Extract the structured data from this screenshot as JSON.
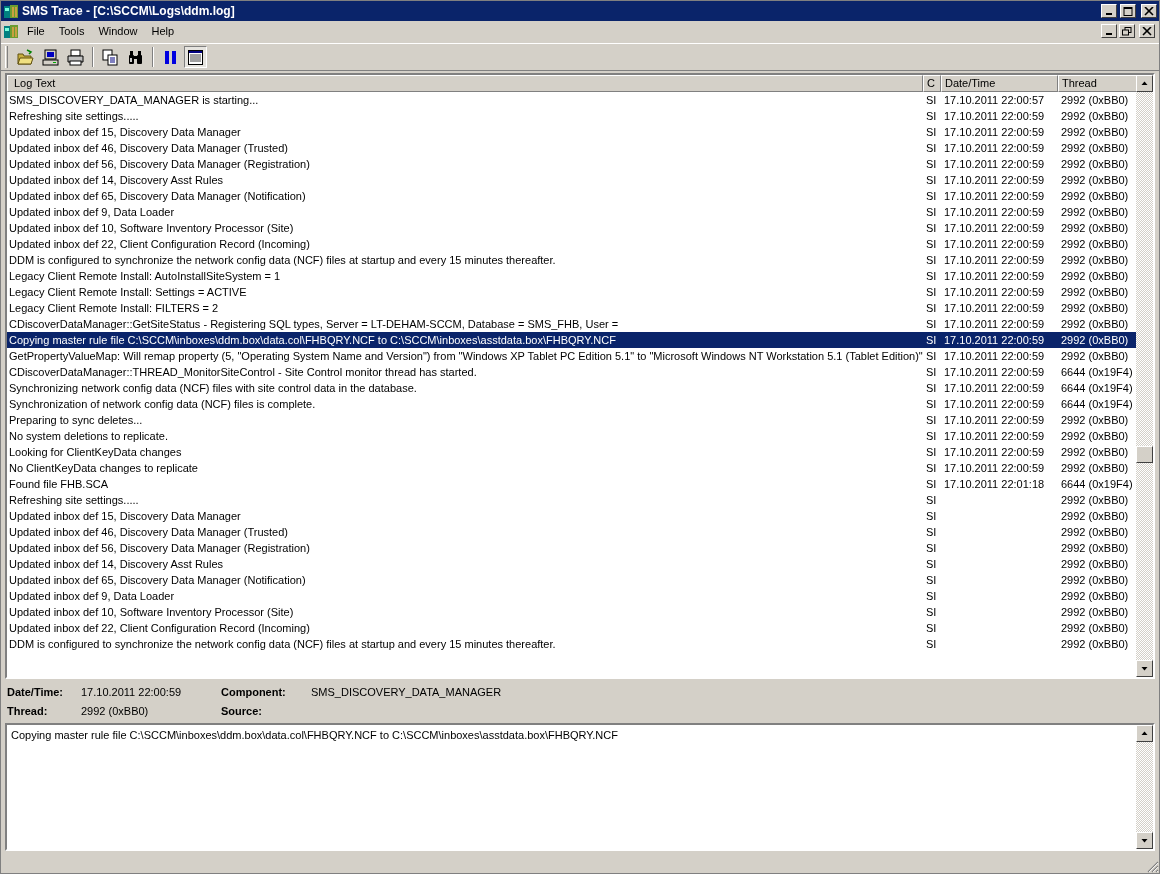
{
  "window": {
    "title": "SMS Trace - [C:\\SCCM\\Logs\\ddm.log]"
  },
  "menu": [
    {
      "label": "File"
    },
    {
      "label": "Tools"
    },
    {
      "label": "Window"
    },
    {
      "label": "Help"
    }
  ],
  "toolbar": [
    {
      "pressed": false
    },
    {
      "pressed": false
    },
    {
      "pressed": false
    },
    {
      "pressed": false
    },
    {
      "pressed": false
    },
    {
      "pressed": false
    },
    {
      "pressed": true
    }
  ],
  "columns": [
    {
      "label": "Log Text"
    },
    {
      "label": "C"
    },
    {
      "label": "Date/Time"
    },
    {
      "label": "Thread"
    }
  ],
  "rows": [
    {
      "text": "SMS_DISCOVERY_DATA_MANAGER is starting...",
      "component": "SI",
      "datetime": "17.10.2011 22:00:57",
      "thread": "2992 (0xBB0)",
      "selected": false
    },
    {
      "text": "Refreshing site settings.....",
      "component": "SI",
      "datetime": "17.10.2011 22:00:59",
      "thread": "2992 (0xBB0)",
      "selected": false
    },
    {
      "text": "Updated inbox def 15, Discovery Data Manager",
      "component": "SI",
      "datetime": "17.10.2011 22:00:59",
      "thread": "2992 (0xBB0)",
      "selected": false
    },
    {
      "text": "Updated inbox def 46, Discovery Data Manager (Trusted)",
      "component": "SI",
      "datetime": "17.10.2011 22:00:59",
      "thread": "2992 (0xBB0)",
      "selected": false
    },
    {
      "text": "Updated inbox def 56, Discovery Data Manager (Registration)",
      "component": "SI",
      "datetime": "17.10.2011 22:00:59",
      "thread": "2992 (0xBB0)",
      "selected": false
    },
    {
      "text": "Updated inbox def 14, Discovery Asst Rules",
      "component": "SI",
      "datetime": "17.10.2011 22:00:59",
      "thread": "2992 (0xBB0)",
      "selected": false
    },
    {
      "text": "Updated inbox def 65, Discovery Data Manager (Notification)",
      "component": "SI",
      "datetime": "17.10.2011 22:00:59",
      "thread": "2992 (0xBB0)",
      "selected": false
    },
    {
      "text": "Updated inbox def 9, Data Loader",
      "component": "SI",
      "datetime": "17.10.2011 22:00:59",
      "thread": "2992 (0xBB0)",
      "selected": false
    },
    {
      "text": "Updated inbox def 10, Software Inventory Processor (Site)",
      "component": "SI",
      "datetime": "17.10.2011 22:00:59",
      "thread": "2992 (0xBB0)",
      "selected": false
    },
    {
      "text": "Updated inbox def 22, Client Configuration Record (Incoming)",
      "component": "SI",
      "datetime": "17.10.2011 22:00:59",
      "thread": "2992 (0xBB0)",
      "selected": false
    },
    {
      "text": "DDM is configured to synchronize the network config data (NCF) files at startup and every 15 minutes thereafter.",
      "component": "SI",
      "datetime": "17.10.2011 22:00:59",
      "thread": "2992 (0xBB0)",
      "selected": false
    },
    {
      "text": "Legacy Client Remote Install: AutoInstallSiteSystem = 1",
      "component": "SI",
      "datetime": "17.10.2011 22:00:59",
      "thread": "2992 (0xBB0)",
      "selected": false
    },
    {
      "text": "Legacy Client Remote Install: Settings = ACTIVE",
      "component": "SI",
      "datetime": "17.10.2011 22:00:59",
      "thread": "2992 (0xBB0)",
      "selected": false
    },
    {
      "text": "Legacy Client Remote Install: FILTERS = 2",
      "component": "SI",
      "datetime": "17.10.2011 22:00:59",
      "thread": "2992 (0xBB0)",
      "selected": false
    },
    {
      "text": "CDiscoverDataManager::GetSiteStatus - Registering SQL types, Server = LT-DEHAM-SCCM, Database = SMS_FHB, User =",
      "component": "SI",
      "datetime": "17.10.2011 22:00:59",
      "thread": "2992 (0xBB0)",
      "selected": false
    },
    {
      "text": "Copying master rule file C:\\SCCM\\inboxes\\ddm.box\\data.col\\FHBQRY.NCF to C:\\SCCM\\inboxes\\asstdata.box\\FHBQRY.NCF",
      "component": "SI",
      "datetime": "17.10.2011 22:00:59",
      "thread": "2992 (0xBB0)",
      "selected": true
    },
    {
      "text": "GetPropertyValueMap: Will remap property (5, \"Operating System Name and Version\") from \"Windows XP Tablet PC Edition 5.1\" to \"Microsoft Windows NT Workstation 5.1 (Tablet Edition)\"",
      "component": "SI",
      "datetime": "17.10.2011 22:00:59",
      "thread": "2992 (0xBB0)",
      "selected": false
    },
    {
      "text": "CDiscoverDataManager::THREAD_MonitorSiteControl - Site Control monitor thread has started.",
      "component": "SI",
      "datetime": "17.10.2011 22:00:59",
      "thread": "6644 (0x19F4)",
      "selected": false
    },
    {
      "text": "Synchronizing network config data (NCF) files with site control data in the database.",
      "component": "SI",
      "datetime": "17.10.2011 22:00:59",
      "thread": "6644 (0x19F4)",
      "selected": false
    },
    {
      "text": "Synchronization of network config data (NCF) files is complete.",
      "component": "SI",
      "datetime": "17.10.2011 22:00:59",
      "thread": "6644 (0x19F4)",
      "selected": false
    },
    {
      "text": "Preparing to sync deletes...",
      "component": "SI",
      "datetime": "17.10.2011 22:00:59",
      "thread": "2992 (0xBB0)",
      "selected": false
    },
    {
      "text": "No system deletions to replicate.",
      "component": "SI",
      "datetime": "17.10.2011 22:00:59",
      "thread": "2992 (0xBB0)",
      "selected": false
    },
    {
      "text": "Looking for ClientKeyData changes",
      "component": "SI",
      "datetime": "17.10.2011 22:00:59",
      "thread": "2992 (0xBB0)",
      "selected": false
    },
    {
      "text": "No ClientKeyData changes to replicate",
      "component": "SI",
      "datetime": "17.10.2011 22:00:59",
      "thread": "2992 (0xBB0)",
      "selected": false
    },
    {
      "text": "Found file FHB.SCA",
      "component": "SI",
      "datetime": "17.10.2011 22:01:18",
      "thread": "6644 (0x19F4)",
      "selected": false
    },
    {
      "text": "Refreshing site settings.....",
      "component": "SI",
      "thread": "2992 (0xBB0)",
      "selected": false
    },
    {
      "text": "Updated inbox def 15, Discovery Data Manager",
      "component": "SI",
      "thread": "2992 (0xBB0)",
      "selected": false
    },
    {
      "text": "Updated inbox def 46, Discovery Data Manager (Trusted)",
      "component": "SI",
      "thread": "2992 (0xBB0)",
      "selected": false
    },
    {
      "text": "Updated inbox def 56, Discovery Data Manager (Registration)",
      "component": "SI",
      "thread": "2992 (0xBB0)",
      "selected": false
    },
    {
      "text": "Updated inbox def 14, Discovery Asst Rules",
      "component": "SI",
      "thread": "2992 (0xBB0)",
      "selected": false
    },
    {
      "text": "Updated inbox def 65, Discovery Data Manager (Notification)",
      "component": "SI",
      "thread": "2992 (0xBB0)",
      "selected": false
    },
    {
      "text": "Updated inbox def 9, Data Loader",
      "component": "SI",
      "thread": "2992 (0xBB0)",
      "selected": false
    },
    {
      "text": "Updated inbox def 10, Software Inventory Processor (Site)",
      "component": "SI",
      "thread": "2992 (0xBB0)",
      "selected": false
    },
    {
      "text": "Updated inbox def 22, Client Configuration Record (Incoming)",
      "component": "SI",
      "thread": "2992 (0xBB0)",
      "selected": false
    },
    {
      "text": "DDM is configured to synchronize the network config data (NCF) files at startup and every 15 minutes thereafter.",
      "component": "SI",
      "thread": "2992 (0xBB0)",
      "selected": false
    }
  ],
  "details": {
    "datetime_label": "Date/Time:",
    "datetime": "17.10.2011 22:00:59",
    "component_label": "Component:",
    "component": "SMS_DISCOVERY_DATA_MANAGER",
    "thread_label": "Thread:",
    "thread": "2992 (0xBB0)",
    "source_label": "Source:"
  },
  "message": {
    "text": "Copying master rule file C:\\SCCM\\inboxes\\ddm.box\\data.col\\FHBQRY.NCF to C:\\SCCM\\inboxes\\asstdata.box\\FHBQRY.NCF"
  }
}
